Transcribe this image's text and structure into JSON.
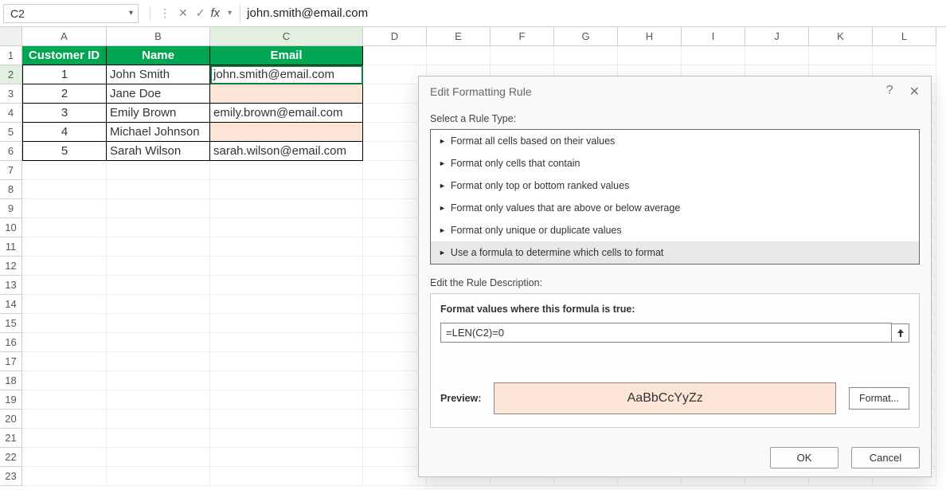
{
  "formula_bar": {
    "cell_ref": "C2",
    "fx_label": "fx",
    "formula_value": "john.smith@email.com"
  },
  "columns": [
    "A",
    "B",
    "C",
    "D",
    "E",
    "F",
    "G",
    "H",
    "I",
    "J",
    "K",
    "L"
  ],
  "row_numbers_visible": 23,
  "table": {
    "headers": [
      "Customer ID",
      "Name",
      "Email"
    ],
    "rows": [
      {
        "id": "1",
        "name": "John Smith",
        "email": "john.smith@email.com",
        "highlight": false
      },
      {
        "id": "2",
        "name": "Jane Doe",
        "email": "",
        "highlight": true
      },
      {
        "id": "3",
        "name": "Emily Brown",
        "email": "emily.brown@email.com",
        "highlight": false
      },
      {
        "id": "4",
        "name": "Michael Johnson",
        "email": "",
        "highlight": true
      },
      {
        "id": "5",
        "name": "Sarah Wilson",
        "email": "sarah.wilson@email.com",
        "highlight": false
      }
    ]
  },
  "active_cell": {
    "row": 2,
    "col": "C"
  },
  "dialog": {
    "title": "Edit Formatting Rule",
    "help_icon": "?",
    "close_icon": "✕",
    "section_rule_type": "Select a Rule Type:",
    "rule_types": [
      "Format all cells based on their values",
      "Format only cells that contain",
      "Format only top or bottom ranked values",
      "Format only values that are above or below average",
      "Format only unique or duplicate values",
      "Use a formula to determine which cells to format"
    ],
    "selected_rule_index": 5,
    "section_rule_desc": "Edit the Rule Description:",
    "desc_head": "Format values where this formula is true:",
    "formula": "=LEN(C2)=0",
    "preview_label": "Preview:",
    "preview_text": "AaBbCcYyZz",
    "format_btn": "Format...",
    "ok_btn": "OK",
    "cancel_btn": "Cancel"
  }
}
